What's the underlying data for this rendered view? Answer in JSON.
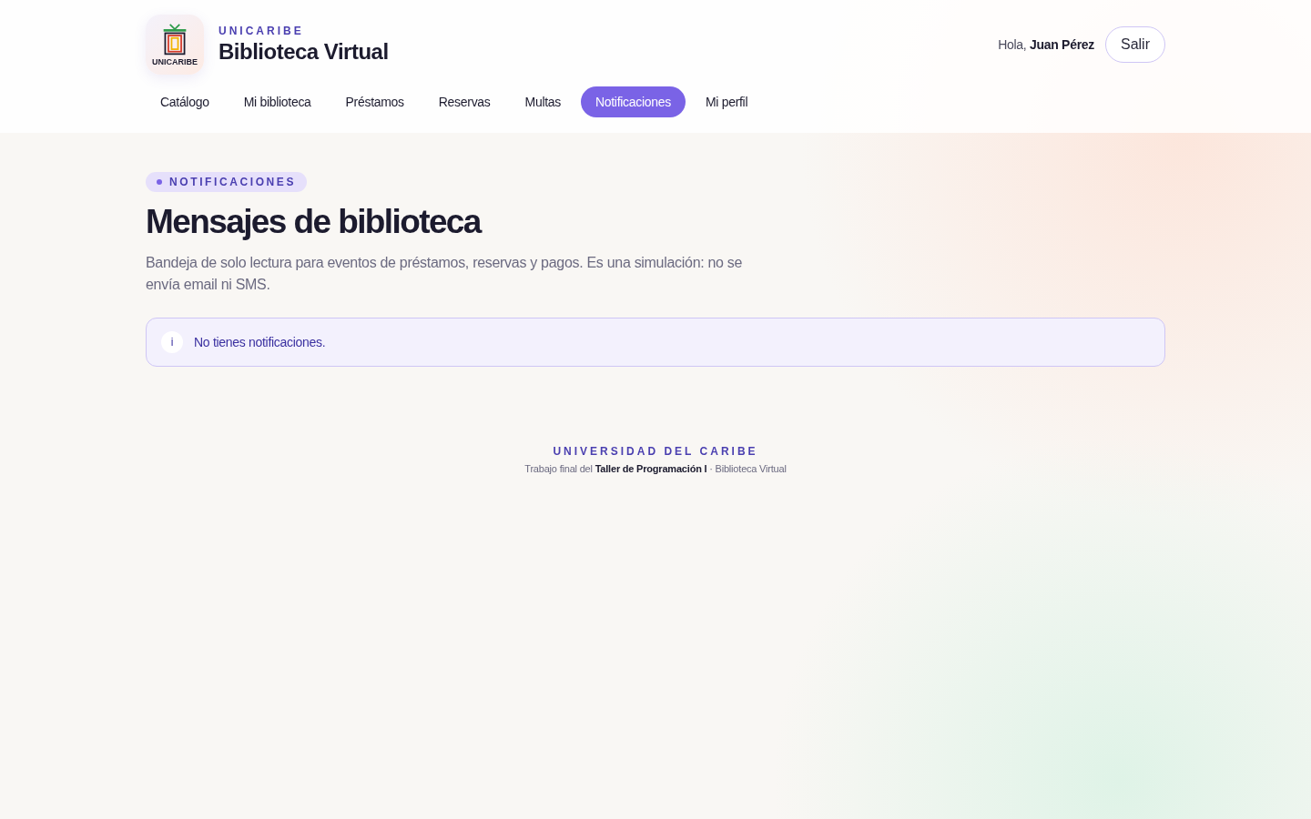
{
  "header": {
    "logo_text": "UNICARIBE",
    "eyebrow": "UNICARIBE",
    "title": "Biblioteca Virtual",
    "greeting": "Hola,",
    "user": "Juan Pérez",
    "logout": "Salir"
  },
  "nav": [
    {
      "label": "Catálogo",
      "selected": false
    },
    {
      "label": "Mi biblioteca",
      "selected": false
    },
    {
      "label": "Préstamos",
      "selected": false
    },
    {
      "label": "Reservas",
      "selected": false
    },
    {
      "label": "Multas",
      "selected": false
    },
    {
      "label": "Notificaciones",
      "selected": true
    },
    {
      "label": "Mi perfil",
      "selected": false
    }
  ],
  "page": {
    "badge": "NOTIFICACIONES",
    "title": "Mensajes de biblioteca",
    "description": "Bandeja de solo lectura para eventos de préstamos, reservas y pagos. Es una simulación: no se envía email ni SMS.",
    "notice": {
      "icon": "i",
      "text": "No tienes notificaciones."
    }
  },
  "footer": {
    "org": "UNIVERSIDAD DEL CARIBE",
    "text": "Trabajo final del **Taller de Programación I** · Biblioteca Virtual"
  }
}
